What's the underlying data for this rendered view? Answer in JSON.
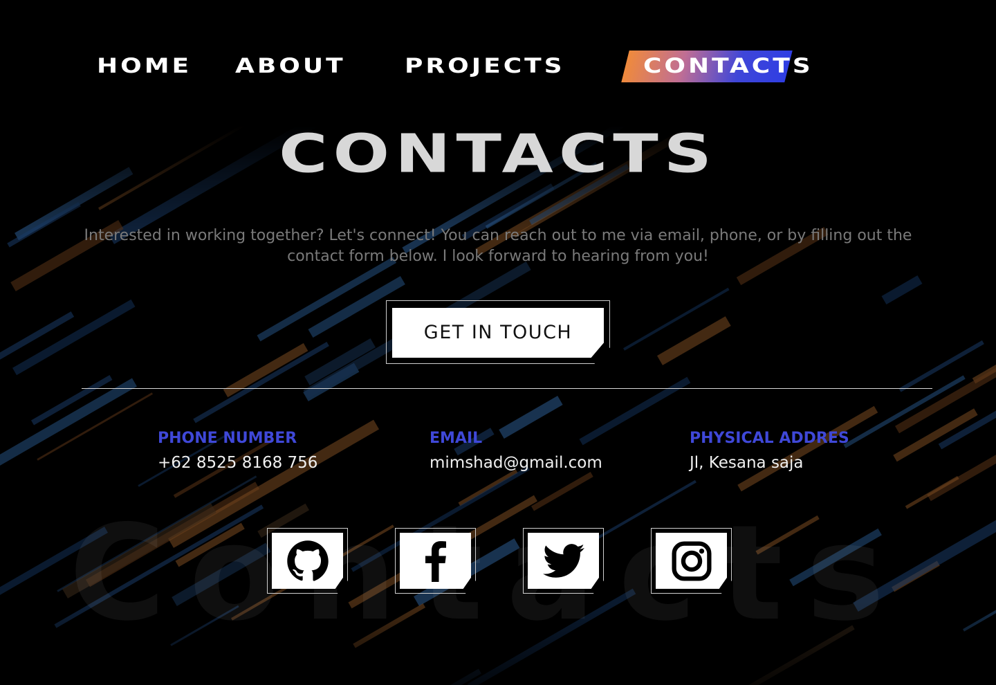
{
  "nav": {
    "items": [
      {
        "label": "Home"
      },
      {
        "label": "About"
      },
      {
        "label": "Projects"
      },
      {
        "label": "Contacts"
      }
    ],
    "active_index": 3
  },
  "main": {
    "heading": "Contacts",
    "intro": "Interested in working together? Let's connect! You can reach out to me via email, phone, or by filling out the contact form below. I look forward to hearing from you!",
    "cta_label": "GET IN TOUCH"
  },
  "contact": {
    "phone": {
      "label": "PHONE NUMBER",
      "value": "+62 8525 8168 756"
    },
    "email": {
      "label": "EMAIL",
      "value": "mimshad@gmail.com"
    },
    "address": {
      "label": "PHYSICAL ADDRES",
      "value": "Jl, Kesana saja"
    }
  },
  "social": [
    {
      "icon": "github-icon"
    },
    {
      "icon": "facebook-icon"
    },
    {
      "icon": "twitter-icon"
    },
    {
      "icon": "instagram-icon"
    }
  ],
  "colors": {
    "accent_blue": "#3f48d8",
    "accent_orange": "#ef8a3c",
    "background": "#000000"
  }
}
